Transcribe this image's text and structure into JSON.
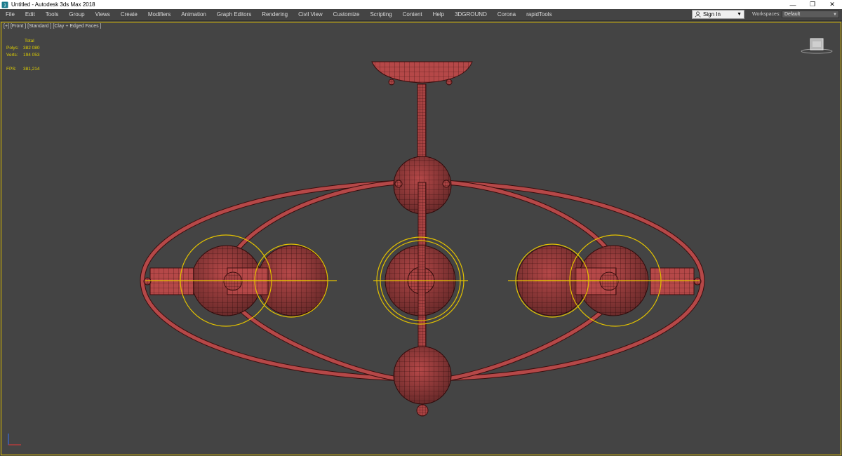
{
  "window": {
    "title": "Untitled - Autodesk 3ds Max 2018",
    "controls": {
      "minimize": "—",
      "restore": "❐",
      "close": "✕"
    }
  },
  "menu": {
    "items": [
      "File",
      "Edit",
      "Tools",
      "Group",
      "Views",
      "Create",
      "Modifiers",
      "Animation",
      "Graph Editors",
      "Rendering",
      "Civil View",
      "Customize",
      "Scripting",
      "Content",
      "Help",
      "3DGROUND",
      "Corona",
      "rapidTools"
    ]
  },
  "signin": {
    "label": "Sign In"
  },
  "workspaces": {
    "label": "Workspaces:",
    "value": "Default"
  },
  "viewport": {
    "labels": [
      "[+]",
      "[Front ]",
      "[Standard ]",
      "[Clay + Edged Faces ]"
    ],
    "stats": {
      "header": "Total",
      "polys_label": "Polys:",
      "polys_value": "382 080",
      "verts_label": "Verts:",
      "verts_value": "194 053",
      "fps_label": "FPS:",
      "fps_value": "381,214"
    }
  },
  "colors": {
    "viewport_bg": "#444444",
    "mesh": "#b54848",
    "wire": "#3a0e0e",
    "selection": "#e3c200"
  },
  "icons": {
    "app": "3dsmax-app-icon",
    "user": "user-icon",
    "viewcube": "viewcube-icon",
    "axis": "axis-tripod-icon"
  }
}
